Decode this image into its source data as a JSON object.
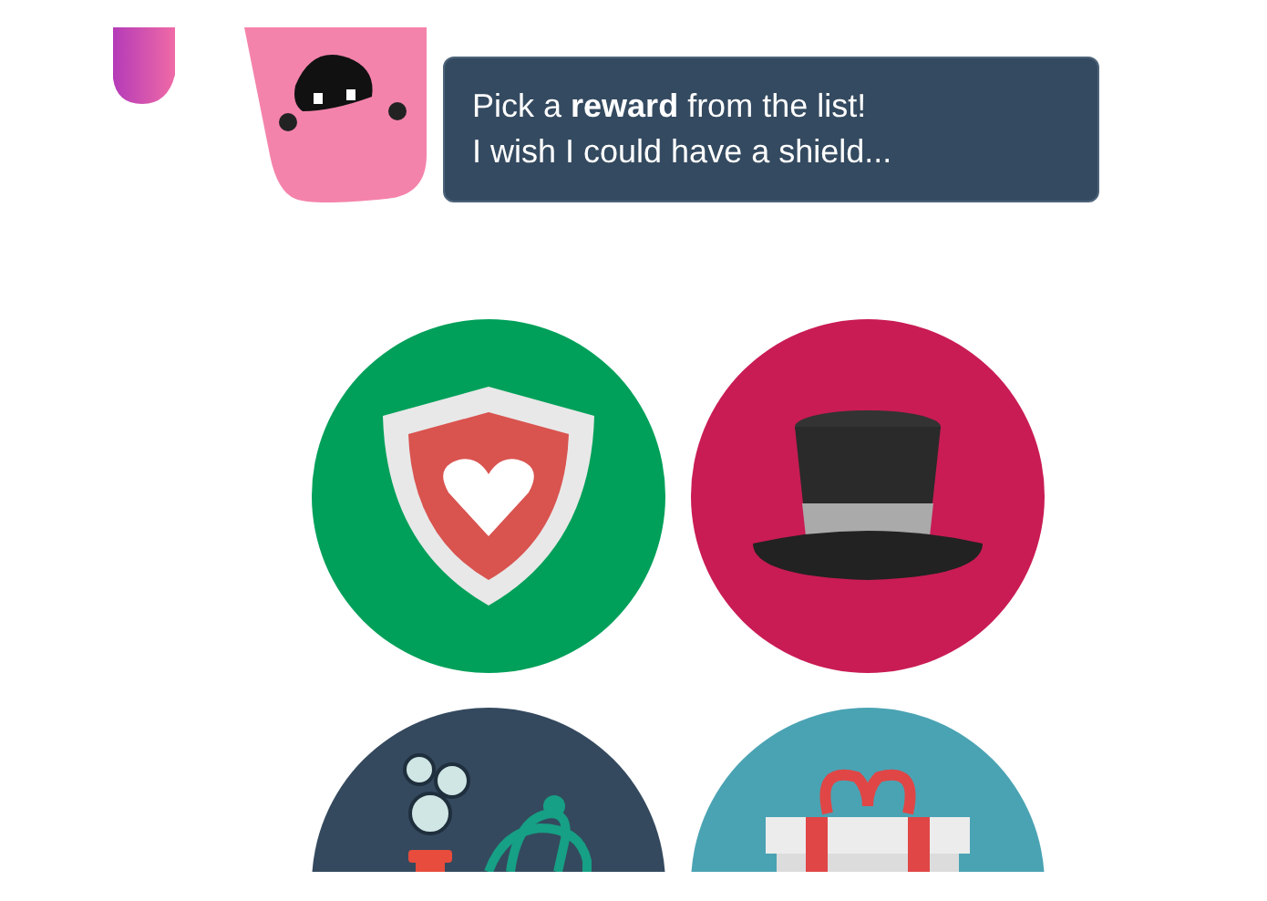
{
  "speech_bubble": {
    "lines": [
      "Pick a **reward** from the list!",
      "I wish I could have a shield..."
    ]
  },
  "rewards": [
    {
      "kind": "shield",
      "color": "#00a05a"
    },
    {
      "kind": "hat",
      "color": "#c91c54"
    },
    {
      "kind": "science",
      "color": "#34495e"
    },
    {
      "kind": "gift",
      "color": "#4aa3b3"
    }
  ]
}
